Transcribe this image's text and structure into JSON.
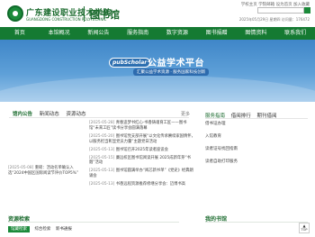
{
  "header": {
    "school_name_cn": "广东建设职业技术学院",
    "school_name_en": "GUANGDONG CONSTRUCTION POLYTECHNIC",
    "library_name": "图书馆",
    "top_links": "学校主页 学院邮箱 设为首页 加入收藏",
    "search_placeholder": "",
    "datetime": "2025年05月29日 星期四 访问量：176472"
  },
  "nav": {
    "items": [
      "首页",
      "本馆概况",
      "新闻公告",
      "服务指南",
      "数字资源",
      "图书捐赠",
      "图情资料",
      "联系我们"
    ]
  },
  "banner": {
    "logo_text": "pubScholar",
    "title": "公益学术平台",
    "subtitle": "汇聚公益学术资源 · 服务国家科技创新"
  },
  "news": {
    "tabs": [
      "馆内公告",
      "新闻动态",
      "资源动态"
    ],
    "more": "更多",
    "items": [
      {
        "date": "[2025-05-28]",
        "text": "青春追梦书红心·书香铸魂育工匠——图书馆“未来工匠”读书分享会圆满落幕"
      },
      {
        "date": "[2025-05-20]",
        "text": "图书馆党支部开展“以文化传承赓续家国情怀，以服务担当彰显党员力量”主题党日活动"
      },
      {
        "date": "[2025-05-13]",
        "text": "图书馆召开2025年读者座谈会"
      },
      {
        "date": "[2025-05-15]",
        "text": "廉远校区图书馆阅读开展 2025成新年芽“书烟”活动"
      },
      {
        "date": "[2025-05-13]",
        "text": "图书馆圆满举办“阅芯新书单”《党史》经典朗诵会"
      },
      {
        "date": "[2025-05-13]",
        "text": "书香远程资源推荐修缮分享会：迈博书高"
      }
    ],
    "featured": {
      "date": "[2025-05-08]",
      "text": "重磅：活动名单确认入选“2024中国区国际阅读节评价TOP5%”"
    }
  },
  "right_panel": {
    "tabs": [
      "服务指南",
      "借阅排行",
      "期刊借阅"
    ],
    "items": [
      "借书证办理",
      "入馆教育",
      "读者证号找回指南",
      "读者自助打印服务"
    ]
  },
  "resources": {
    "title": "资源检索",
    "tabs": [
      "馆藏检索",
      "综合检索",
      "新书通报"
    ]
  },
  "my_library": {
    "title": "我的书馆"
  },
  "top_button": "TOP"
}
